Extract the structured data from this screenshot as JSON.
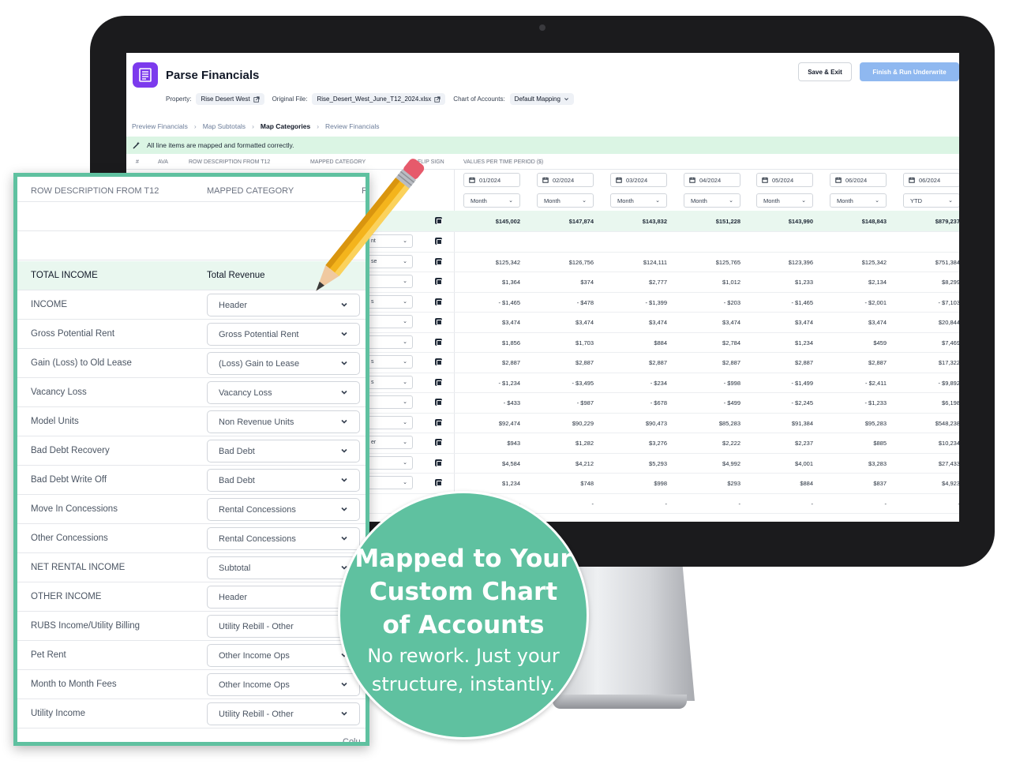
{
  "app": {
    "title": "Parse Financials",
    "property_label": "Property:",
    "property_value": "Rise Desert West",
    "file_label": "Original File:",
    "file_value": "Rise_Desert_West_June_T12_2024.xlsx",
    "coa_label": "Chart of Accounts:",
    "coa_value": "Default Mapping",
    "save_label": "Save & Exit",
    "finish_label": "Finish & Run Underwrite"
  },
  "breadcrumbs": [
    "Preview Financials",
    "Map Subtotals",
    "Map Categories",
    "Review Financials"
  ],
  "banner": "All line items are mapped and formatted correctly.",
  "columns": {
    "num": "#",
    "ava": "AVA",
    "row_description": "ROW DESCRIPTION FROM T12",
    "mapped_category": "MAPPED CATEGORY",
    "flip_sign": "FLIP SIGN",
    "values": "VALUES PER TIME PERIOD ($)"
  },
  "periods": [
    {
      "date": "01/2024",
      "type": "Month"
    },
    {
      "date": "02/2024",
      "type": "Month"
    },
    {
      "date": "03/2024",
      "type": "Month"
    },
    {
      "date": "04/2024",
      "type": "Month"
    },
    {
      "date": "05/2024",
      "type": "Month"
    },
    {
      "date": "06/2024",
      "type": "Month"
    },
    {
      "date": "06/2024",
      "type": "YTD"
    }
  ],
  "totals": [
    "$145,002",
    "$147,874",
    "$143,832",
    "$151,228",
    "$143,990",
    "$148,843",
    "$879,237"
  ],
  "value_rows": [
    [
      "",
      "",
      "",
      "",
      "",
      "",
      ""
    ],
    [
      "$125,342",
      "$126,756",
      "$124,111",
      "$125,765",
      "$123,396",
      "$125,342",
      "$751,384"
    ],
    [
      "$1,364",
      "$374",
      "$2,777",
      "$1,012",
      "$1,233",
      "$2,134",
      "$8,299"
    ],
    [
      "- $1,465",
      "- $478",
      "- $1,399",
      "- $203",
      "- $1,465",
      "- $2,001",
      "- $7,103"
    ],
    [
      "$3,474",
      "$3,474",
      "$3,474",
      "$3,474",
      "$3,474",
      "$3,474",
      "$20,844"
    ],
    [
      "$1,856",
      "$1,703",
      "$884",
      "$2,784",
      "$1,234",
      "$459",
      "$7,469"
    ],
    [
      "$2,887",
      "$2,887",
      "$2,887",
      "$2,887",
      "$2,887",
      "$2,887",
      "$17,322"
    ],
    [
      "- $1,234",
      "- $3,495",
      "- $234",
      "- $998",
      "- $1,499",
      "- $2,411",
      "- $9,892"
    ],
    [
      "- $433",
      "- $987",
      "- $678",
      "- $499",
      "- $2,245",
      "- $1,233",
      "$6,198"
    ],
    [
      "$92,474",
      "$90,229",
      "$90,473",
      "$85,283",
      "$91,384",
      "$95,283",
      "$548,238"
    ],
    [
      "$943",
      "$1,282",
      "$3,276",
      "$2,222",
      "$2,237",
      "$885",
      "$10,234"
    ],
    [
      "$4,584",
      "$4,212",
      "$5,293",
      "$4,992",
      "$4,001",
      "$3,283",
      "$27,433"
    ],
    [
      "$1,234",
      "$748",
      "$998",
      "$293",
      "$884",
      "$837",
      "$4,923"
    ],
    [
      "-",
      "-",
      "-",
      "-",
      "-",
      "-",
      "-"
    ]
  ],
  "partial_cells": [
    "nt",
    "se",
    "",
    "s",
    "",
    "",
    "s",
    "s",
    "",
    "",
    "er",
    "",
    ""
  ],
  "zoom": {
    "header_description": "ROW DESCRIPTION FROM T12",
    "header_category": "MAPPED CATEGORY",
    "header_partial": "F",
    "total_description": "TOTAL INCOME",
    "total_category": "Total Revenue",
    "rows": [
      {
        "description": "INCOME",
        "category": "Header"
      },
      {
        "description": "Gross Potential Rent",
        "category": "Gross Potential Rent"
      },
      {
        "description": "Gain (Loss) to Old Lease",
        "category": "(Loss) Gain to Lease"
      },
      {
        "description": "Vacancy Loss",
        "category": "Vacancy Loss"
      },
      {
        "description": "Model Units",
        "category": "Non Revenue Units"
      },
      {
        "description": "Bad Debt Recovery",
        "category": "Bad Debt"
      },
      {
        "description": "Bad Debt Write Off",
        "category": "Bad Debt"
      },
      {
        "description": "Move In Concessions",
        "category": "Rental Concessions"
      },
      {
        "description": "Other Concessions",
        "category": "Rental Concessions"
      },
      {
        "description": "NET RENTAL INCOME",
        "category": "Subtotal"
      },
      {
        "description": "OTHER INCOME",
        "category": "Header"
      },
      {
        "description": "RUBS Income/Utility Billing",
        "category": "Utility Rebill - Other"
      },
      {
        "description": "Pet Rent",
        "category": "Other Income Ops"
      },
      {
        "description": "Month to Month Fees",
        "category": "Other Income Ops"
      },
      {
        "description": "Utility Income",
        "category": "Utility Rebill - Other"
      }
    ],
    "footer_partial": "Colu"
  },
  "badge": {
    "lines_bold": [
      "Mapped to Your",
      "Custom Chart",
      "of Accounts"
    ],
    "lines_regular": [
      "No rework. Just your",
      "structure, instantly."
    ]
  },
  "colors": {
    "accent_green": "#5fc1a0",
    "logo_purple": "#7c3aed",
    "finish_button": "#8fb8f0",
    "banner_green": "#dbf5e4"
  },
  "icons": [
    "document-list-icon",
    "external-link-icon",
    "chevron-down-icon",
    "calendar-icon",
    "magic-wand-icon",
    "flip-sign-icon",
    "pencil-icon"
  ]
}
